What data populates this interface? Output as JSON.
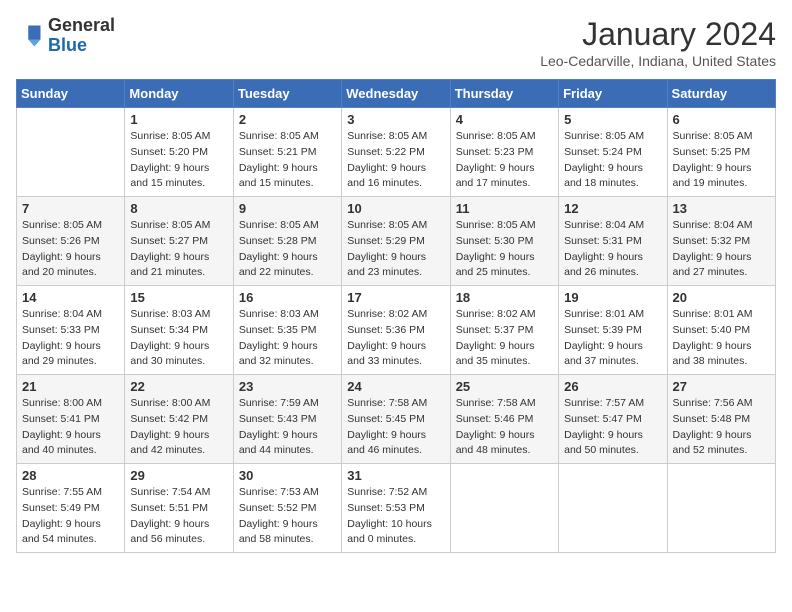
{
  "logo": {
    "line1": "General",
    "line2": "Blue"
  },
  "title": "January 2024",
  "subtitle": "Leo-Cedarville, Indiana, United States",
  "days_of_week": [
    "Sunday",
    "Monday",
    "Tuesday",
    "Wednesday",
    "Thursday",
    "Friday",
    "Saturday"
  ],
  "weeks": [
    [
      {
        "day": "",
        "info": ""
      },
      {
        "day": "1",
        "info": "Sunrise: 8:05 AM\nSunset: 5:20 PM\nDaylight: 9 hours\nand 15 minutes."
      },
      {
        "day": "2",
        "info": "Sunrise: 8:05 AM\nSunset: 5:21 PM\nDaylight: 9 hours\nand 15 minutes."
      },
      {
        "day": "3",
        "info": "Sunrise: 8:05 AM\nSunset: 5:22 PM\nDaylight: 9 hours\nand 16 minutes."
      },
      {
        "day": "4",
        "info": "Sunrise: 8:05 AM\nSunset: 5:23 PM\nDaylight: 9 hours\nand 17 minutes."
      },
      {
        "day": "5",
        "info": "Sunrise: 8:05 AM\nSunset: 5:24 PM\nDaylight: 9 hours\nand 18 minutes."
      },
      {
        "day": "6",
        "info": "Sunrise: 8:05 AM\nSunset: 5:25 PM\nDaylight: 9 hours\nand 19 minutes."
      }
    ],
    [
      {
        "day": "7",
        "info": "Sunrise: 8:05 AM\nSunset: 5:26 PM\nDaylight: 9 hours\nand 20 minutes."
      },
      {
        "day": "8",
        "info": "Sunrise: 8:05 AM\nSunset: 5:27 PM\nDaylight: 9 hours\nand 21 minutes."
      },
      {
        "day": "9",
        "info": "Sunrise: 8:05 AM\nSunset: 5:28 PM\nDaylight: 9 hours\nand 22 minutes."
      },
      {
        "day": "10",
        "info": "Sunrise: 8:05 AM\nSunset: 5:29 PM\nDaylight: 9 hours\nand 23 minutes."
      },
      {
        "day": "11",
        "info": "Sunrise: 8:05 AM\nSunset: 5:30 PM\nDaylight: 9 hours\nand 25 minutes."
      },
      {
        "day": "12",
        "info": "Sunrise: 8:04 AM\nSunset: 5:31 PM\nDaylight: 9 hours\nand 26 minutes."
      },
      {
        "day": "13",
        "info": "Sunrise: 8:04 AM\nSunset: 5:32 PM\nDaylight: 9 hours\nand 27 minutes."
      }
    ],
    [
      {
        "day": "14",
        "info": "Sunrise: 8:04 AM\nSunset: 5:33 PM\nDaylight: 9 hours\nand 29 minutes."
      },
      {
        "day": "15",
        "info": "Sunrise: 8:03 AM\nSunset: 5:34 PM\nDaylight: 9 hours\nand 30 minutes."
      },
      {
        "day": "16",
        "info": "Sunrise: 8:03 AM\nSunset: 5:35 PM\nDaylight: 9 hours\nand 32 minutes."
      },
      {
        "day": "17",
        "info": "Sunrise: 8:02 AM\nSunset: 5:36 PM\nDaylight: 9 hours\nand 33 minutes."
      },
      {
        "day": "18",
        "info": "Sunrise: 8:02 AM\nSunset: 5:37 PM\nDaylight: 9 hours\nand 35 minutes."
      },
      {
        "day": "19",
        "info": "Sunrise: 8:01 AM\nSunset: 5:39 PM\nDaylight: 9 hours\nand 37 minutes."
      },
      {
        "day": "20",
        "info": "Sunrise: 8:01 AM\nSunset: 5:40 PM\nDaylight: 9 hours\nand 38 minutes."
      }
    ],
    [
      {
        "day": "21",
        "info": "Sunrise: 8:00 AM\nSunset: 5:41 PM\nDaylight: 9 hours\nand 40 minutes."
      },
      {
        "day": "22",
        "info": "Sunrise: 8:00 AM\nSunset: 5:42 PM\nDaylight: 9 hours\nand 42 minutes."
      },
      {
        "day": "23",
        "info": "Sunrise: 7:59 AM\nSunset: 5:43 PM\nDaylight: 9 hours\nand 44 minutes."
      },
      {
        "day": "24",
        "info": "Sunrise: 7:58 AM\nSunset: 5:45 PM\nDaylight: 9 hours\nand 46 minutes."
      },
      {
        "day": "25",
        "info": "Sunrise: 7:58 AM\nSunset: 5:46 PM\nDaylight: 9 hours\nand 48 minutes."
      },
      {
        "day": "26",
        "info": "Sunrise: 7:57 AM\nSunset: 5:47 PM\nDaylight: 9 hours\nand 50 minutes."
      },
      {
        "day": "27",
        "info": "Sunrise: 7:56 AM\nSunset: 5:48 PM\nDaylight: 9 hours\nand 52 minutes."
      }
    ],
    [
      {
        "day": "28",
        "info": "Sunrise: 7:55 AM\nSunset: 5:49 PM\nDaylight: 9 hours\nand 54 minutes."
      },
      {
        "day": "29",
        "info": "Sunrise: 7:54 AM\nSunset: 5:51 PM\nDaylight: 9 hours\nand 56 minutes."
      },
      {
        "day": "30",
        "info": "Sunrise: 7:53 AM\nSunset: 5:52 PM\nDaylight: 9 hours\nand 58 minutes."
      },
      {
        "day": "31",
        "info": "Sunrise: 7:52 AM\nSunset: 5:53 PM\nDaylight: 10 hours\nand 0 minutes."
      },
      {
        "day": "",
        "info": ""
      },
      {
        "day": "",
        "info": ""
      },
      {
        "day": "",
        "info": ""
      }
    ]
  ]
}
